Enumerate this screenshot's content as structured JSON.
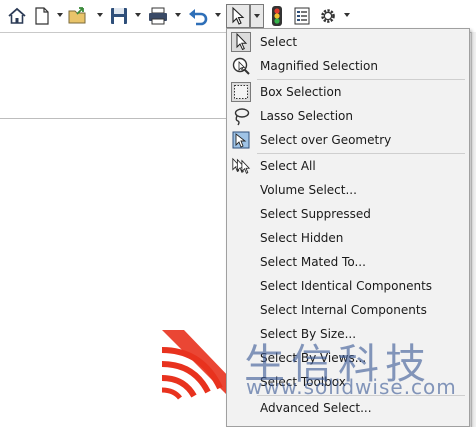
{
  "toolbar": {
    "buttons": [
      {
        "name": "home-icon"
      },
      {
        "name": "new-document-icon"
      },
      {
        "name": "open-folder-icon"
      },
      {
        "name": "save-icon"
      },
      {
        "name": "print-icon"
      },
      {
        "name": "undo-icon"
      },
      {
        "name": "select-arrow-icon",
        "active": true
      },
      {
        "name": "traffic-light-icon"
      },
      {
        "name": "file-properties-icon"
      },
      {
        "name": "options-gear-icon"
      }
    ]
  },
  "select_menu": {
    "items": [
      {
        "label": "Select",
        "icon": "select-arrow-icon"
      },
      {
        "label": "Magnified Selection",
        "icon": "magnifier-select-icon"
      },
      {
        "label": "Box Selection",
        "icon": "box-selection-icon"
      },
      {
        "label": "Lasso Selection",
        "icon": "lasso-icon"
      },
      {
        "label": "Select over Geometry",
        "icon": "select-over-geometry-icon"
      },
      {
        "label": "Select All",
        "icon": "select-all-icon"
      },
      {
        "label": "Volume Select...",
        "icon": ""
      },
      {
        "label": "Select Suppressed",
        "icon": ""
      },
      {
        "label": "Select Hidden",
        "icon": ""
      },
      {
        "label": "Select Mated To...",
        "icon": ""
      },
      {
        "label": "Select Identical Components",
        "icon": ""
      },
      {
        "label": "Select Internal Components",
        "icon": ""
      },
      {
        "label": "Select By Size...",
        "icon": ""
      },
      {
        "label": "Select By Views...",
        "icon": ""
      },
      {
        "label": "Select Toolbox",
        "icon": ""
      },
      {
        "label": "Advanced Select...",
        "icon": ""
      }
    ]
  },
  "watermark": {
    "chinese": "生信科技",
    "url": "www.solidwise.com",
    "color": "#3c5a96",
    "logo_color": "#e8321e"
  }
}
